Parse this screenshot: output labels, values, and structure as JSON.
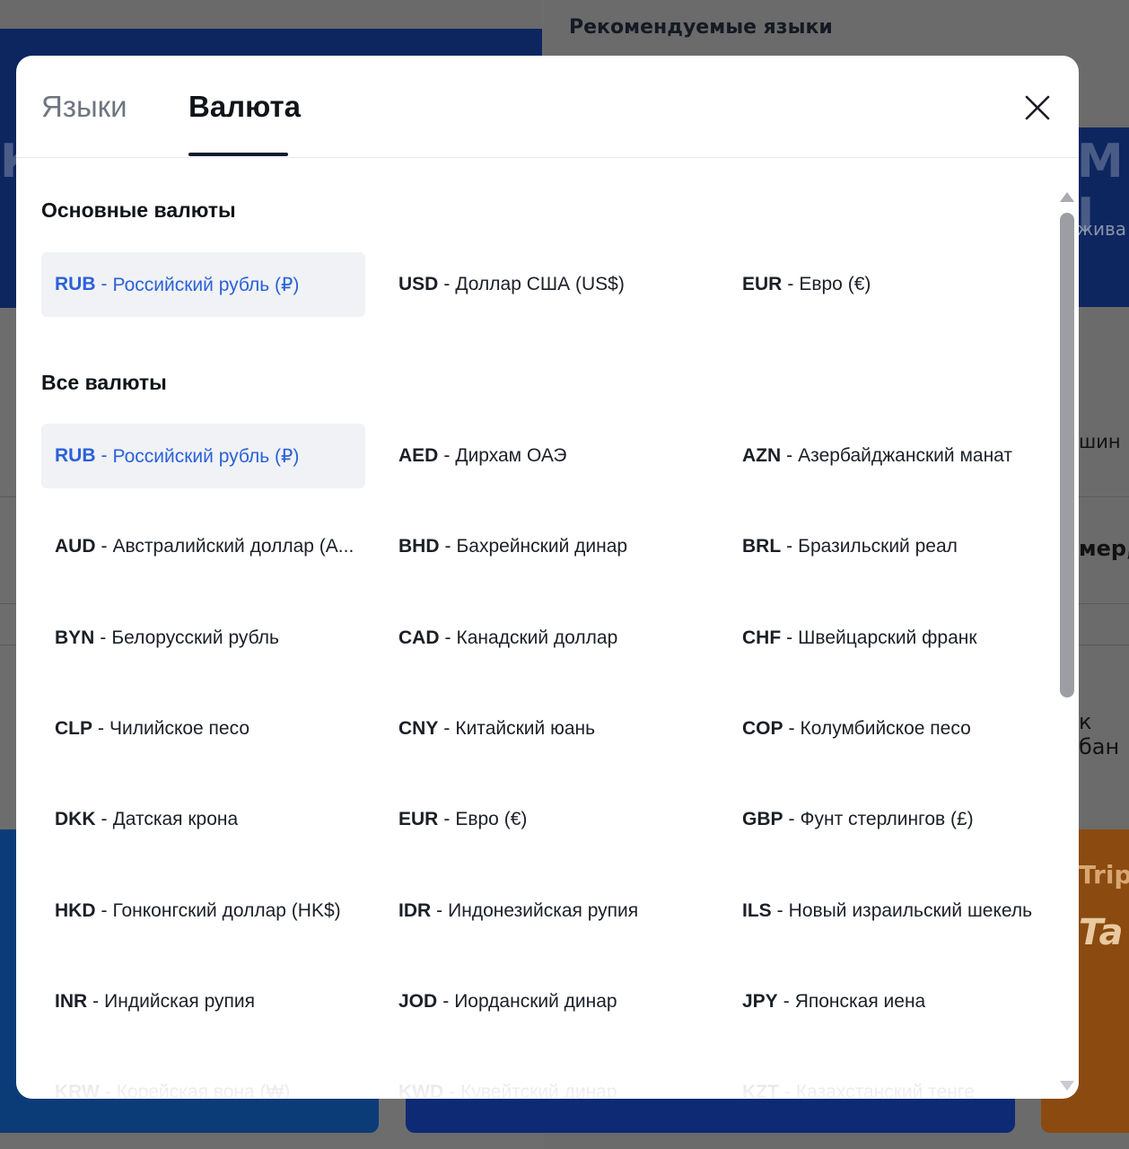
{
  "background": {
    "recommended_languages_title": "Рекомендуемые языки",
    "hero_left_fragment": "К",
    "hero_right_fragment": "М I",
    "hero_right_small": "жива",
    "right_text_1": "шин",
    "right_text_2": "мер,",
    "right_text_3": "к бан",
    "promo_trip": "Trip",
    "promo_ta": "Ta"
  },
  "modal": {
    "tabs": [
      {
        "label": "Языки",
        "active": false
      },
      {
        "label": "Валюта",
        "active": true
      }
    ],
    "close_icon": "close-x-icon",
    "sections": {
      "main_title": "Основные валюты",
      "all_title": "Все валюты"
    },
    "main_currencies": [
      {
        "code": "RUB",
        "name": "Российский рубль (₽)",
        "selected": true
      },
      {
        "code": "USD",
        "name": "Доллар США (US$)",
        "selected": false
      },
      {
        "code": "EUR",
        "name": "Евро (€)",
        "selected": false
      }
    ],
    "all_currencies": [
      {
        "code": "RUB",
        "name": "Российский рубль (₽)",
        "selected": true
      },
      {
        "code": "AED",
        "name": "Дирхам ОАЭ"
      },
      {
        "code": "AZN",
        "name": "Азербайджанский манат"
      },
      {
        "code": "AUD",
        "name": "Австралийский доллар (A..."
      },
      {
        "code": "BHD",
        "name": "Бахрейнский динар"
      },
      {
        "code": "BRL",
        "name": "Бразильский реал"
      },
      {
        "code": "BYN",
        "name": "Белорусский рубль"
      },
      {
        "code": "CAD",
        "name": "Канадский доллар"
      },
      {
        "code": "CHF",
        "name": "Швейцарский франк"
      },
      {
        "code": "CLP",
        "name": "Чилийское песо"
      },
      {
        "code": "CNY",
        "name": "Китайский юань"
      },
      {
        "code": "COP",
        "name": "Колумбийское песо"
      },
      {
        "code": "DKK",
        "name": "Датская крона"
      },
      {
        "code": "EUR",
        "name": "Евро (€)"
      },
      {
        "code": "GBP",
        "name": "Фунт стерлингов (£)"
      },
      {
        "code": "HKD",
        "name": "Гонконгский доллар (HK$)"
      },
      {
        "code": "IDR",
        "name": "Индонезийская рупия"
      },
      {
        "code": "ILS",
        "name": "Новый израильский шекель"
      },
      {
        "code": "INR",
        "name": "Индийская рупия"
      },
      {
        "code": "JOD",
        "name": "Иорданский динар"
      },
      {
        "code": "JPY",
        "name": "Японская иена"
      },
      {
        "code": "KRW",
        "name": "Корейская вона (₩)",
        "faded": true
      },
      {
        "code": "KWD",
        "name": "Кувейтский динар",
        "faded": true
      },
      {
        "code": "KZT",
        "name": "Казахстанский тенге",
        "faded": true
      }
    ],
    "separator": "-",
    "colors": {
      "selected_text": "#2a62d8",
      "selected_bg": "#f1f2f6",
      "active_tab_underline": "#0f1b2d"
    }
  }
}
